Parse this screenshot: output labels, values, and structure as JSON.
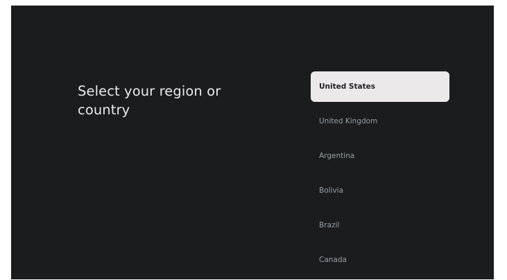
{
  "page": {
    "title": "Select your region or country"
  },
  "regions": {
    "selected_index": 0,
    "items": [
      {
        "label": "United States"
      },
      {
        "label": "United Kingdom"
      },
      {
        "label": "Argentina"
      },
      {
        "label": "Bolivia"
      },
      {
        "label": "Brazil"
      },
      {
        "label": "Canada"
      }
    ]
  }
}
